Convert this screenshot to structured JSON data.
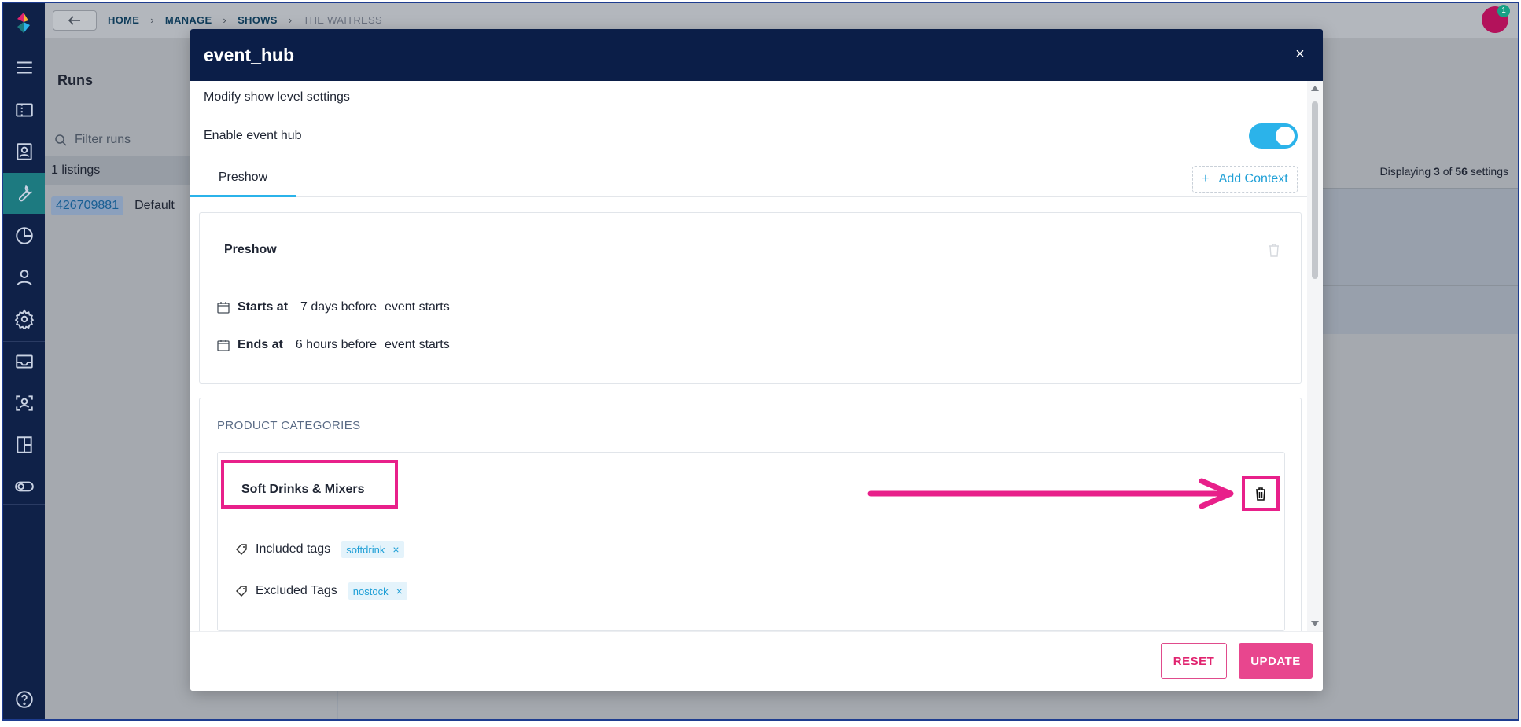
{
  "breadcrumb": {
    "home": "HOME",
    "manage": "MANAGE",
    "shows": "SHOWS",
    "current": "THE WAITRESS"
  },
  "notifications": {
    "count": "1"
  },
  "left_panel": {
    "title": "Runs",
    "filter_placeholder": "Filter runs",
    "count": "1 listings",
    "rows": [
      {
        "id": "426709881",
        "name": "Default"
      }
    ]
  },
  "right_panel": {
    "displaying_prefix": "Displaying ",
    "shown": "3",
    "of": " of ",
    "total": "56",
    "suffix": " settings"
  },
  "modal": {
    "title": "event_hub",
    "close_glyph": "×",
    "subtitle": "Modify show level settings",
    "enable_label": "Enable event hub",
    "enable_on": true,
    "tabs": [
      {
        "label": "Preshow",
        "active": true
      }
    ],
    "add_context_label": "Add Context",
    "add_context_glyph": "+",
    "context_card": {
      "title": "Preshow",
      "starts_label": "Starts at",
      "starts_value": "7 days before",
      "starts_event": "event starts",
      "ends_label": "Ends at",
      "ends_value": "6 hours before",
      "ends_event": "event starts"
    },
    "product_categories": {
      "heading": "PRODUCT CATEGORIES",
      "items": [
        {
          "name": "Soft Drinks & Mixers",
          "included_label": "Included tags",
          "included_tags": [
            "softdrink"
          ],
          "excluded_label": "Excluded Tags",
          "excluded_tags": [
            "nostock"
          ]
        }
      ]
    },
    "chip_remove_glyph": "×",
    "reset_label": "RESET",
    "update_label": "UPDATE"
  },
  "colors": {
    "accent": "#2bb3ea",
    "brand_pink": "#e8468e",
    "header_navy": "#0b1e48",
    "annotation": "#e8208a"
  }
}
